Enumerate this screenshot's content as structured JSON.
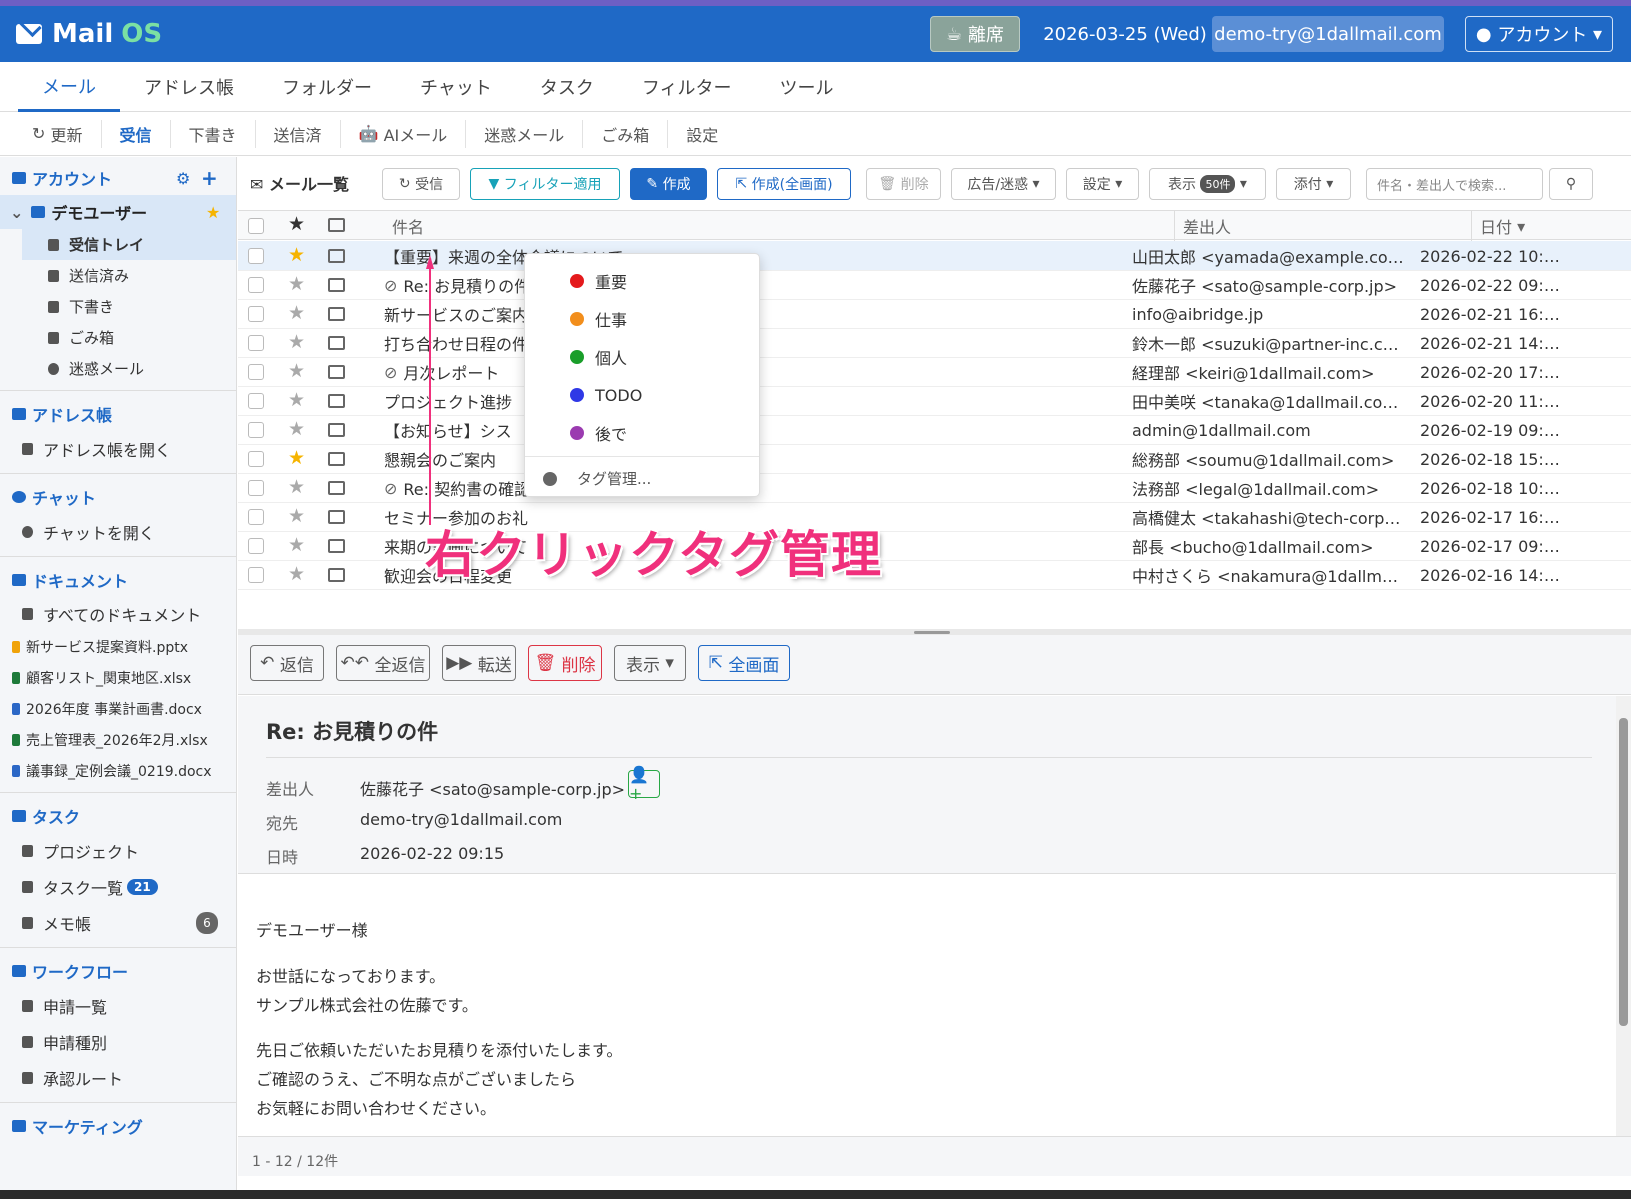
{
  "brand": {
    "name": "Mail",
    "os": "OS"
  },
  "header": {
    "away": "離席",
    "date": "2026-03-25 (Wed)",
    "email": "demo-try@1dallmail.com",
    "account": "アカウント"
  },
  "tabs": [
    "メール",
    "アドレス帳",
    "フォルダー",
    "チャット",
    "タスク",
    "フィルター",
    "ツール"
  ],
  "subnav": [
    "更新",
    "受信",
    "下書き",
    "送信済",
    "AIメール",
    "迷惑メール",
    "ごみ箱",
    "設定"
  ],
  "sidebar": {
    "account_title": "アカウント",
    "user": "デモユーザー",
    "folders": [
      "受信トレイ",
      "送信済み",
      "下書き",
      "ごみ箱",
      "迷惑メール"
    ],
    "address_title": "アドレス帳",
    "address_open": "アドレス帳を開く",
    "chat_title": "チャット",
    "chat_open": "チャットを開く",
    "docs_title": "ドキュメント",
    "docs_all": "すべてのドキュメント",
    "docs": [
      "新サービス提案資料.pptx",
      "顧客リスト_関東地区.xlsx",
      "2026年度 事業計画書.docx",
      "売上管理表_2026年2月.xlsx",
      "議事録_定例会議_0219.docx"
    ],
    "task_title": "タスク",
    "project": "プロジェクト",
    "tasklist": "タスク一覧",
    "tasklist_count": "21",
    "memo": "メモ帳",
    "memo_count": "6",
    "workflow_title": "ワークフロー",
    "wf": [
      "申請一覧",
      "申請種別",
      "承認ルート"
    ],
    "more": "マーケティング"
  },
  "toolbar": {
    "title": "メール一覧",
    "receive": "受信",
    "filter": "フィルター適用",
    "compose": "作成",
    "compose_full": "作成(全画面)",
    "delete": "削除",
    "ad": "広告/迷惑",
    "settings": "設定",
    "display": "表示",
    "display_count": "50件",
    "attach": "添付",
    "search_placeholder": "件名・差出人で検索..."
  },
  "columns": {
    "subject": "件名",
    "from": "差出人",
    "date": "日付"
  },
  "emails": [
    {
      "starred": true,
      "clip": false,
      "subject": "【重要】来週の全体会議について",
      "from": "山田太郎 <yamada@example.co…",
      "date": "2026-02-22 10:…"
    },
    {
      "starred": false,
      "clip": true,
      "subject": "Re: お見積りの件",
      "from": "佐藤花子 <sato@sample-corp.jp>",
      "date": "2026-02-22 09:…"
    },
    {
      "starred": false,
      "clip": false,
      "subject": "新サービスのご案内",
      "from": "info@aibridge.jp",
      "date": "2026-02-21 16:…"
    },
    {
      "starred": false,
      "clip": false,
      "subject": "打ち合わせ日程の件",
      "from": "鈴木一郎 <suzuki@partner-inc.c…",
      "date": "2026-02-21 14:…"
    },
    {
      "starred": false,
      "clip": true,
      "subject": "月次レポート",
      "from": "経理部 <keiri@1dallmail.com>",
      "date": "2026-02-20 17:…"
    },
    {
      "starred": false,
      "clip": false,
      "subject": "プロジェクト進捗",
      "from": "田中美咲 <tanaka@1dallmail.co…",
      "date": "2026-02-20 11:…"
    },
    {
      "starred": false,
      "clip": false,
      "subject": "【お知らせ】シス",
      "from": "admin@1dallmail.com",
      "date": "2026-02-19 09:…"
    },
    {
      "starred": true,
      "clip": false,
      "subject": "懇親会のご案内",
      "from": "総務部 <soumu@1dallmail.com>",
      "date": "2026-02-18 15:…"
    },
    {
      "starred": false,
      "clip": true,
      "subject": "Re: 契約書の確認依頼",
      "from": "法務部 <legal@1dallmail.com>",
      "date": "2026-02-18 10:…"
    },
    {
      "starred": false,
      "clip": false,
      "subject": "セミナー参加のお礼",
      "from": "高橋健太 <takahashi@tech-corp…",
      "date": "2026-02-17 16:…"
    },
    {
      "starred": false,
      "clip": false,
      "subject": "来期の計画について",
      "from": "部長 <bucho@1dallmail.com>",
      "date": "2026-02-17 09:…"
    },
    {
      "starred": false,
      "clip": false,
      "subject": "歓迎会の日程変更",
      "from": "中村さくら <nakamura@1dallm…",
      "date": "2026-02-16 14:…"
    }
  ],
  "context_menu": {
    "tags": [
      {
        "label": "重要",
        "color": "#e41a1c"
      },
      {
        "label": "仕事",
        "color": "#f28e1c"
      },
      {
        "label": "個人",
        "color": "#1a9e2a"
      },
      {
        "label": "TODO",
        "color": "#2f38e6"
      },
      {
        "label": "後で",
        "color": "#9b3bb0"
      }
    ],
    "manage": "タグ管理..."
  },
  "annotation": "右クリックタグ管理",
  "actions": {
    "reply": "返信",
    "reply_all": "全返信",
    "forward": "転送",
    "delete": "削除",
    "display": "表示",
    "fullscreen": "全画面"
  },
  "message": {
    "subject": "Re: お見積りの件",
    "from_label": "差出人",
    "from": "佐藤花子 <sato@sample-corp.jp>",
    "to_label": "宛先",
    "to": "demo-try@1dallmail.com",
    "date_label": "日時",
    "date": "2026-02-22 09:15",
    "body": [
      "デモユーザー様",
      "お世話になっております。",
      "サンプル株式会社の佐藤です。",
      "先日ご依頼いただいたお見積りを添付いたします。",
      "ご確認のうえ、ご不明な点がございましたら",
      "お気軽にお問い合わせください。"
    ]
  },
  "footer": "1 - 12 / 12件"
}
